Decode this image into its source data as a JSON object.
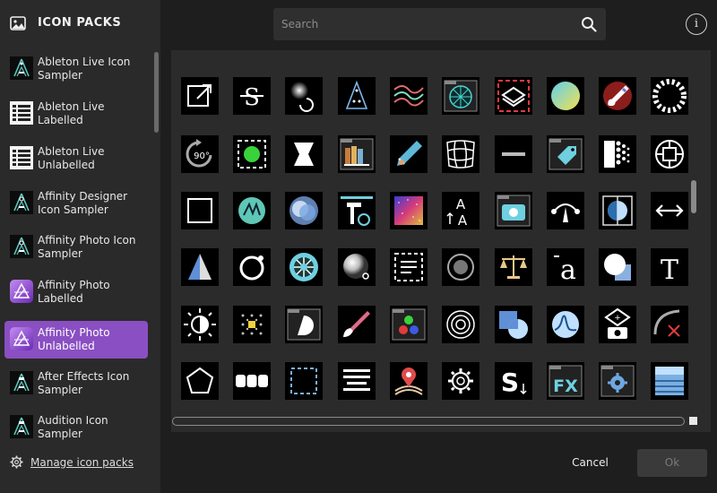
{
  "header": {
    "title": "ICON PACKS",
    "icon": "image-icon"
  },
  "search": {
    "placeholder": "Search",
    "icon": "search-icon"
  },
  "info": {
    "label": "i"
  },
  "packs": [
    {
      "label": "Ableton Live Icon Sampler",
      "thumb": "ableton-sampler"
    },
    {
      "label": "Ableton Live Labelled",
      "thumb": "ableton-list"
    },
    {
      "label": "Ableton Live Unlabelled",
      "thumb": "ableton-list"
    },
    {
      "label": "Affinity Designer Icon Sampler",
      "thumb": "affinity-sampler"
    },
    {
      "label": "Affinity Photo Icon Sampler",
      "thumb": "affinity-sampler"
    },
    {
      "label": "Affinity Photo Labelled",
      "thumb": "affinity-photo"
    },
    {
      "label": "Affinity Photo Unlabelled",
      "thumb": "affinity-photo",
      "selected": true
    },
    {
      "label": "After Effects Icon Sampler",
      "thumb": "ae-sampler"
    },
    {
      "label": "Audition Icon Sampler",
      "thumb": "ae-sampler"
    }
  ],
  "manage": {
    "label": "Manage icon packs"
  },
  "buttons": {
    "cancel": "Cancel",
    "ok": "Ok"
  },
  "colors": {
    "selected": "#8a4fc2",
    "panel": "#2a2a2a",
    "grid": "#2b2b2b",
    "tile": "#000000"
  },
  "icons": [
    "export-icon",
    "strikethrough-icon",
    "dodge-brush-icon",
    "triangle-dots-icon",
    "wave-lines-icon",
    "radial-folder-icon",
    "marquee-layer-icon",
    "gradient-circle-icon",
    "paint-brush-icon",
    "striped-circle-icon",
    "rotate-90-icon",
    "selection-square-icon",
    "hourglass-shape-icon",
    "library-folder-icon",
    "pencil-tip-icon",
    "mesh-warp-icon",
    "minus-icon",
    "price-tag-icon",
    "halftone-icon",
    "globe-circle-icon",
    "square-outline-icon",
    "triangle-badge-icon",
    "color-blend-icon",
    "hammer-tool-icon",
    "color-noise-icon",
    "text-case-icon",
    "camera-folder-icon",
    "pen-node-icon",
    "split-circle-icon",
    "horizontal-arrows-icon",
    "triangle-split-icon",
    "ring-circle-icon",
    "radial-wheel-icon",
    "glow-sphere-icon",
    "dashed-document-icon",
    "donut-circle-icon",
    "scales-icon",
    "character-a-icon",
    "circle-square-icon",
    "text-t-icon",
    "brightness-sun-icon",
    "dot-grid-icon",
    "half-circle-folder-icon",
    "brush-icon",
    "rgb-folder-icon",
    "concentric-circles-icon",
    "shape-pie-icon",
    "curve-circle-icon",
    "lens-camera-icon",
    "arc-cross-icon",
    "pentagon-icon",
    "segmented-bar-icon",
    "dashed-square-icon",
    "align-lines-icon",
    "person-pin-icon",
    "gear-outline-icon",
    "text-s-icon",
    "fx-text-icon",
    "gear-folder-icon",
    "layers-panel-icon"
  ]
}
